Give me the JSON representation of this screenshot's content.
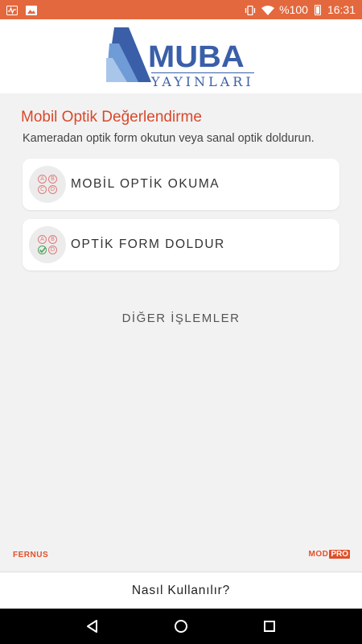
{
  "status_bar": {
    "battery_text": "%100",
    "time": "16:31",
    "icons": [
      "activity-icon",
      "image-icon",
      "vibrate-icon",
      "wifi-icon",
      "battery-charging-icon"
    ]
  },
  "header": {
    "logo_main": "MUBA",
    "logo_sub": "YAYINLARI"
  },
  "main": {
    "title": "Mobil Optik Değerlendirme",
    "subtitle": "Kameradan optik form okutun veya sanal optik doldurun.",
    "cards": [
      {
        "label": "MOBİL OPTİK OKUMA",
        "icon": "abcd-bubbles-icon"
      },
      {
        "label": "OPTİK FORM DOLDUR",
        "icon": "abcd-checked-bubbles-icon"
      }
    ],
    "other_label": "DİĞER İŞLEMLER",
    "bubble_letters": [
      "A",
      "B",
      "C",
      "D"
    ]
  },
  "footer": {
    "left_brand": "FERNUS",
    "right_brand_part1": "MOD",
    "right_brand_part2": "PRO",
    "howto_label": "Nasıl Kullanılır?"
  },
  "colors": {
    "status_bar": "#e4683d",
    "accent": "#d9482b",
    "logo_blue": "#3a5fa8",
    "background": "#f2f2f2"
  }
}
